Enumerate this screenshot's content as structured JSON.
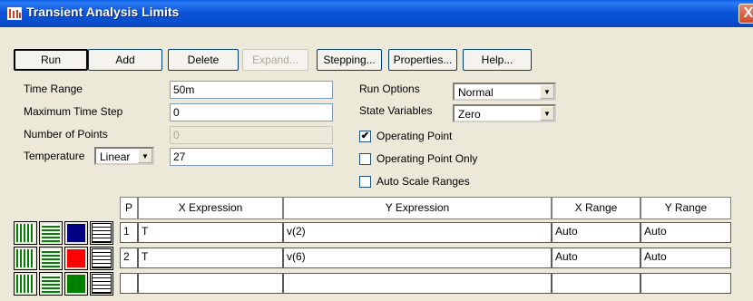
{
  "window": {
    "title": "Transient Analysis Limits",
    "close_glyph": "X"
  },
  "toolbar": {
    "run": "Run",
    "add": "Add",
    "delete": "Delete",
    "expand": "Expand...",
    "stepping": "Stepping...",
    "properties": "Properties...",
    "help": "Help..."
  },
  "form": {
    "time_range_label": "Time Range",
    "time_range_value": "50m",
    "max_step_label": "Maximum Time Step",
    "max_step_value": "0",
    "num_points_label": "Number of Points",
    "num_points_value": "0",
    "temperature_label": "Temperature",
    "temperature_mode": "Linear",
    "temperature_value": "27",
    "run_options_label": "Run Options",
    "run_options_value": "Normal",
    "state_vars_label": "State Variables",
    "state_vars_value": "Zero",
    "checkboxes": [
      {
        "label": "Operating Point",
        "checked": true,
        "mark": "✔"
      },
      {
        "label": "Operating Point Only",
        "checked": false,
        "mark": ""
      },
      {
        "label": "Auto Scale Ranges",
        "checked": false,
        "mark": ""
      }
    ]
  },
  "grid": {
    "headers": {
      "p": "P",
      "x_expr": "X Expression",
      "y_expr": "Y Expression",
      "x_range": "X Range",
      "y_range": "Y Range"
    },
    "rows": [
      {
        "p": "1",
        "x_expr": "T",
        "y_expr": "v(2)",
        "x_range": "Auto",
        "y_range": "Auto",
        "color": "#000080"
      },
      {
        "p": "2",
        "x_expr": "T",
        "y_expr": "v(6)",
        "x_range": "Auto",
        "y_range": "Auto",
        "color": "#ff0000"
      },
      {
        "p": "",
        "x_expr": "",
        "y_expr": "",
        "x_range": "",
        "y_range": "",
        "color": "#008000"
      }
    ]
  }
}
